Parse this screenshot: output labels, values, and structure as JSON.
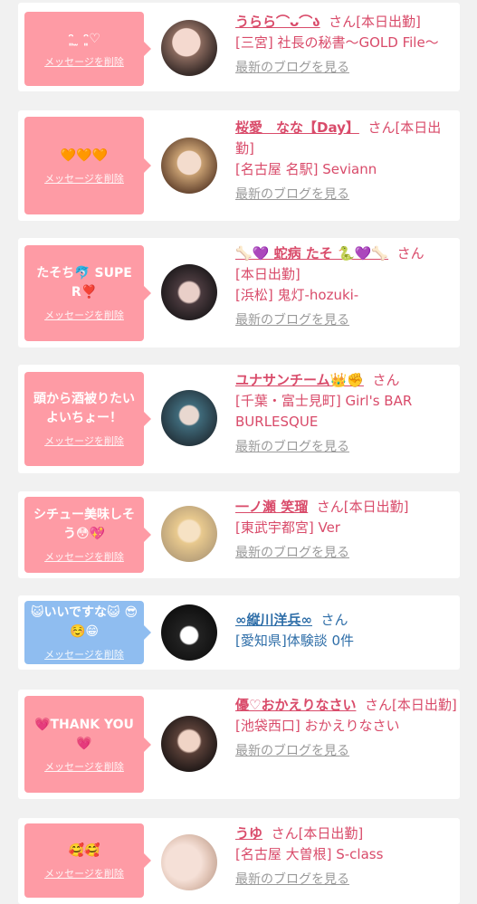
{
  "delete_label": "メッセージを削除",
  "blog_label": "最新のブログを見る",
  "san": "さん",
  "cards": [
    {
      "message": "ᵔ͈ ̫ ᵔ͈♡",
      "name": "うらら⌒ᴗ⌒ა",
      "status": "[本日出勤]",
      "shop": "[三宮] 社長の秘書〜GOLD File〜"
    },
    {
      "message": "🧡🧡🧡",
      "name": "桜愛　なな【Day】",
      "status": "[本日出勤]",
      "shop": "[名古屋 名駅] Seviann"
    },
    {
      "message": "たそち🐬 SUPER❣️",
      "name": "🦴💜 蛇病 たそ 🐍💜🦴",
      "status": "[本日出勤]",
      "shop": "[浜松] 鬼灯-hozuki-"
    },
    {
      "message": "頭から酒被りたい よいちょー！",
      "name": "ユナサンチーム👑✊",
      "status": "",
      "shop": "[千葉・富士見町] Girl's BAR BURLESQUE"
    },
    {
      "message": "シチュー美味しそう😳💖",
      "name": "一ノ瀬 笑瑠",
      "status": "[本日出勤]",
      "shop": "[東武宇都宮] Ver"
    },
    {
      "message": "😺いいですな😺 😎☺️😁",
      "name": "∞縦川洋兵∞",
      "status": "",
      "shop": "[愛知県]体験談 0件"
    },
    {
      "message": "💗THANK YOU💗",
      "name": "優♡おかえりなさい",
      "status": "[本日出勤]",
      "shop": "[池袋西口] おかえりなさい"
    },
    {
      "message": "🥰🥰",
      "name": "うゆ",
      "status": "[本日出勤]",
      "shop": "[名古屋 大曽根] S-class"
    }
  ],
  "colors": {
    "pink_bubble": "#fe9ba5",
    "blue_bubble": "#8fbdf0",
    "accent": "#d94b6a",
    "link_blue": "#2e6ea8"
  }
}
